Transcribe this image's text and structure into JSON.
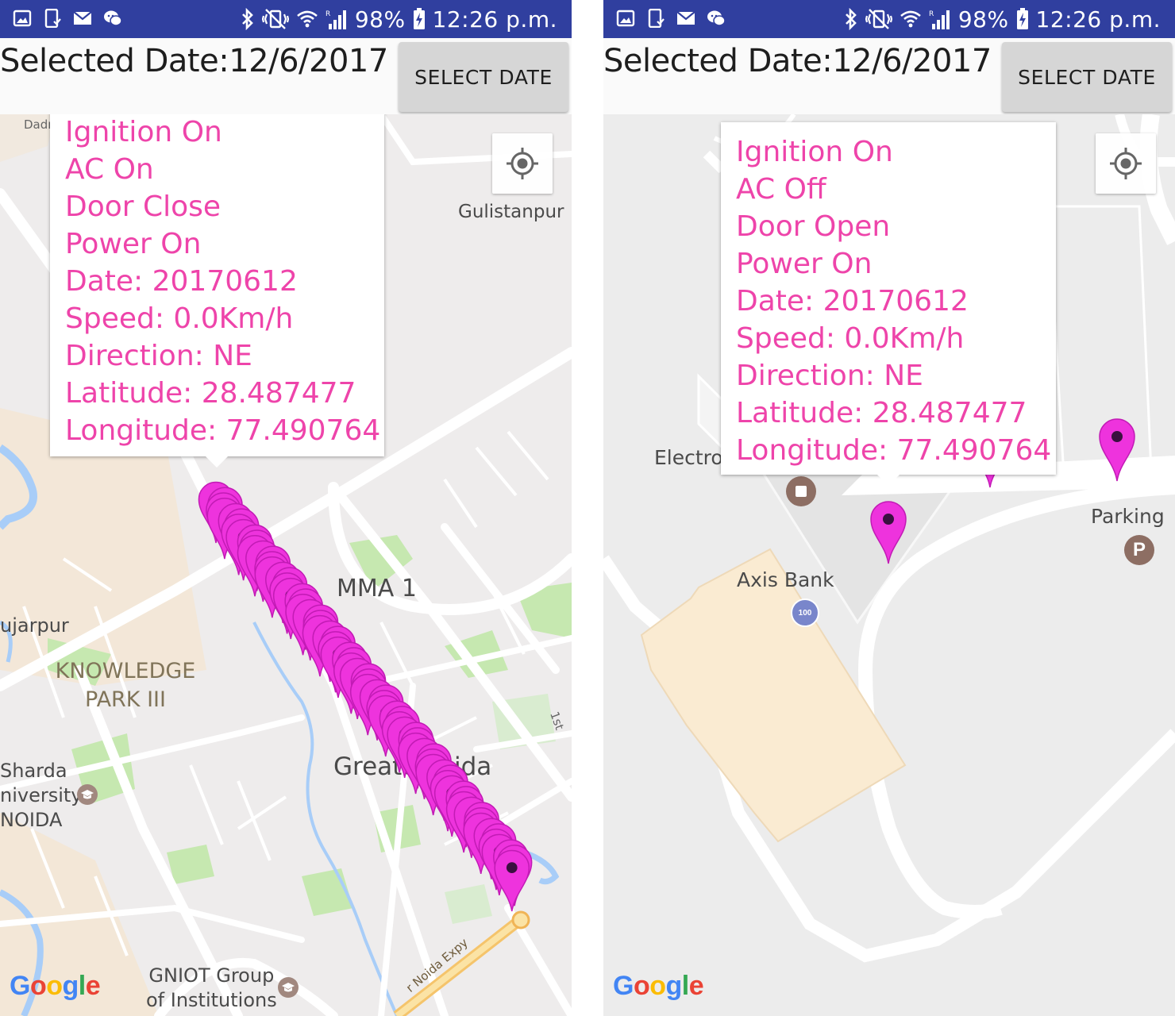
{
  "status_bar": {
    "battery": "98%",
    "time": "12:26 p.m."
  },
  "screens": [
    {
      "selected_date": "Selected Date:12/6/2017",
      "select_button": "SELECT DATE",
      "info": {
        "ignition": "Ignition On",
        "ac": "AC On",
        "door": "Door Close",
        "power": "Power On",
        "date": "Date: 20170612",
        "speed": "Speed: 0.0Km/h",
        "direction": "Direction: NE",
        "latitude": "Latitude: 28.487477",
        "longitude": "Longitude: 77.490764"
      },
      "places": {
        "dadri": "Dadri",
        "gulistanpur": "Gulistanpur",
        "mma": "MMA 1",
        "gujarpur": "ujarpur",
        "knowledge_park": "KNOWLEDGE",
        "knowledge_park_2": "PARK III",
        "greater_noida": "Greater",
        "greater_noida_2": "ida",
        "sharda_1": "Sharda",
        "sharda_2": "niversity",
        "sharda_3": "NOIDA",
        "gniot_1": "GNIOT Group",
        "gniot_2": "of Institutions",
        "expressway": "r Noida Expy",
        "road_1st": "1st"
      },
      "attribution": "Google"
    },
    {
      "selected_date": "Selected Date:12/6/2017",
      "select_button": "SELECT DATE",
      "info": {
        "ignition": "Ignition On",
        "ac": "AC Off",
        "door": "Door Open",
        "power": "Power On",
        "date": "Date: 20170612",
        "speed": "Speed: 0.0Km/h",
        "direction": "Direction: NE",
        "latitude": "Latitude: 28.487477",
        "longitude": "Longitude: 77.490764"
      },
      "places": {
        "electron": "Electron",
        "axis_bank": "Axis Bank",
        "parking": "Parking",
        "atm_badge": "100",
        "parking_badge": "P"
      },
      "attribution": "Google"
    }
  ],
  "colors": {
    "status_bar": "#303f9f",
    "marker": "#ee33dd",
    "info_text": "#ee44aa",
    "map_bg": "#eeecec",
    "water": "#a8cdf8",
    "park": "#c6e8b0"
  },
  "icons": [
    "gallery-icon",
    "tablet-icon",
    "mail-icon",
    "wechat-icon",
    "bluetooth-icon",
    "vibrate-icon",
    "wifi-icon",
    "signal-icon",
    "battery-charging-icon",
    "my-location-icon",
    "map-marker-icon",
    "graduation-cap-icon",
    "atm-icon",
    "parking-icon"
  ]
}
